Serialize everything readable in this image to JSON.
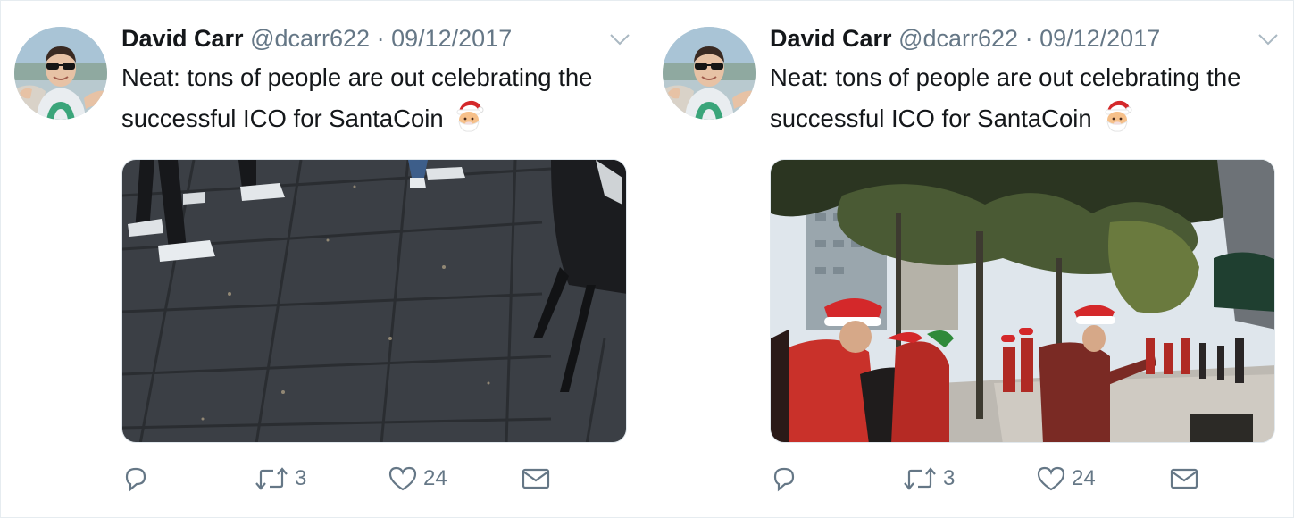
{
  "tweets": [
    {
      "author_name": "David Carr",
      "handle": "@dcarr622",
      "separator": "·",
      "date": "09/12/2017",
      "text": "Neat: tons of people are out celebrating the successful ICO for SantaCoin",
      "emoji": "santa-emoji",
      "media": "Photo of a paved sidewalk with people's sneakers and a chair",
      "retweet_count": "3",
      "like_count": "24"
    },
    {
      "author_name": "David Carr",
      "handle": "@dcarr622",
      "separator": "·",
      "date": "09/12/2017",
      "text": "Neat: tons of people are out celebrating the successful ICO for SantaCoin",
      "emoji": "santa-emoji",
      "media": "Photo of a tree-lined street with people in Santa hats",
      "retweet_count": "3",
      "like_count": "24"
    }
  ],
  "colors": {
    "text": "#14171a",
    "muted": "#657786",
    "border": "#e6ecf0"
  }
}
